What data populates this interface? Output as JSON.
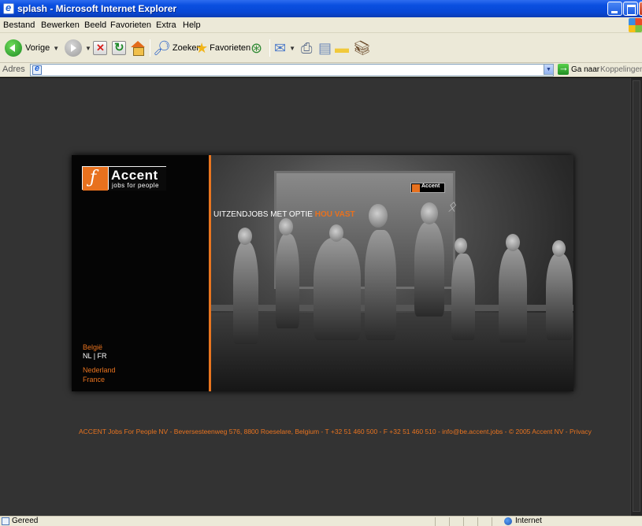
{
  "window": {
    "title": "splash - Microsoft Internet Explorer"
  },
  "menu": {
    "items": [
      "Bestand",
      "Bewerken",
      "Beeld",
      "Favorieten",
      "Extra",
      "Help"
    ]
  },
  "toolbar": {
    "back_label": "Vorige",
    "search_label": "Zoeken",
    "favorites_label": "Favorieten"
  },
  "address": {
    "label": "Adres",
    "value": "",
    "go_label": "Ga naar",
    "links_label": "Koppelingen"
  },
  "page": {
    "brand": "Accent",
    "tagline": "jobs for people",
    "region_belgium": "België",
    "lang_nl": "NL",
    "lang_sep": "|",
    "lang_fr": "FR",
    "region_netherlands": "Nederland",
    "region_france": "France",
    "headline_main": "UITZENDJOBS MET OPTIE ",
    "headline_accent": "HOU VAST",
    "footer": "ACCENT Jobs For People NV - Beversesteenweg 576, 8800 Roeselare, Belgium - T +32 51 460 500 - F +32 51 460 510 - info@be.accent.jobs - © 2005 Accent NV - Privacy"
  },
  "status": {
    "text": "Gereed",
    "zone": "Internet"
  },
  "colors": {
    "accent_orange": "#e8731f",
    "page_bg": "#333333",
    "xp_titlebar": "#0a4fe0"
  }
}
